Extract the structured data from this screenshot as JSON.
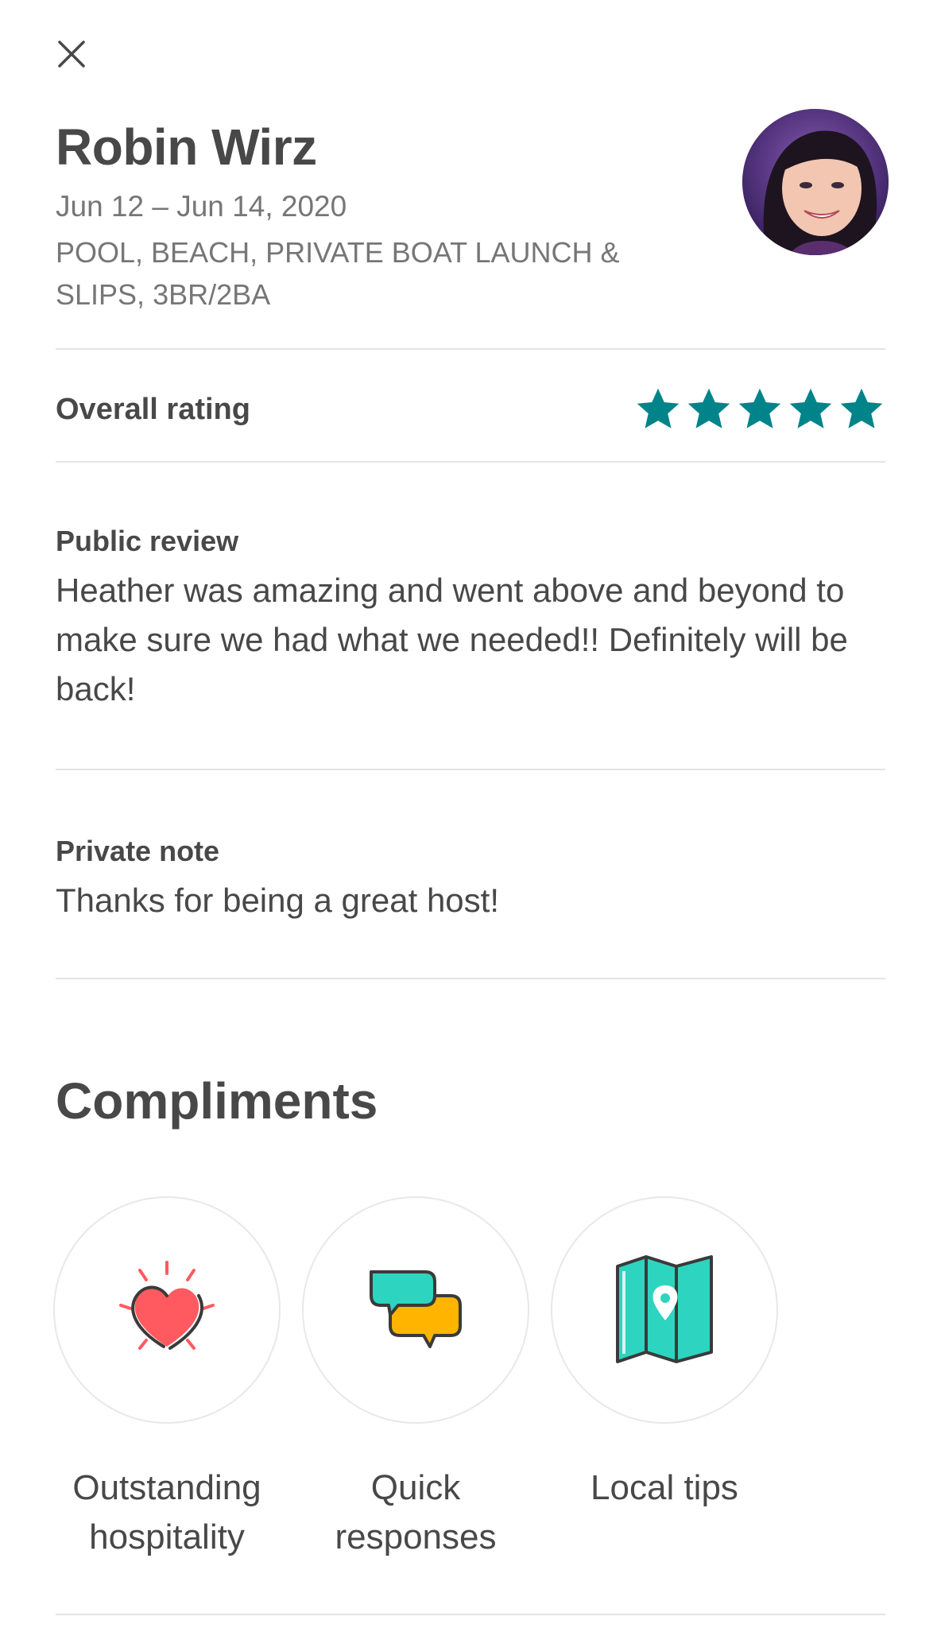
{
  "header": {
    "close_icon": "close-icon",
    "guest_name": "Robin Wirz",
    "dates": "Jun 12 – Jun 14, 2020",
    "listing_title": "POOL, BEACH, PRIVATE BOAT LAUNCH & SLIPS, 3BR/2BA",
    "avatar": "guest-avatar"
  },
  "rating": {
    "label": "Overall rating",
    "stars": 5,
    "max_stars": 5,
    "star_color": "#008489"
  },
  "public_review": {
    "label": "Public review",
    "text": "Heather was amazing and went above and beyond to make sure we had what we needed!! Definitely will be back!"
  },
  "private_note": {
    "label": "Private note",
    "text": "Thanks for being a great host!"
  },
  "compliments": {
    "title": "Compliments",
    "items": [
      {
        "icon": "heart-icon",
        "label": "Outstanding hospitality"
      },
      {
        "icon": "chat-bubbles-icon",
        "label": "Quick responses"
      },
      {
        "icon": "map-icon",
        "label": "Local tips"
      }
    ]
  },
  "colors": {
    "accent_teal": "#008489",
    "heart_red": "#FF5A5F",
    "bubble_teal": "#2DD4BF",
    "bubble_yellow": "#FFB400",
    "text_dark": "#484848",
    "text_muted": "#767676"
  }
}
